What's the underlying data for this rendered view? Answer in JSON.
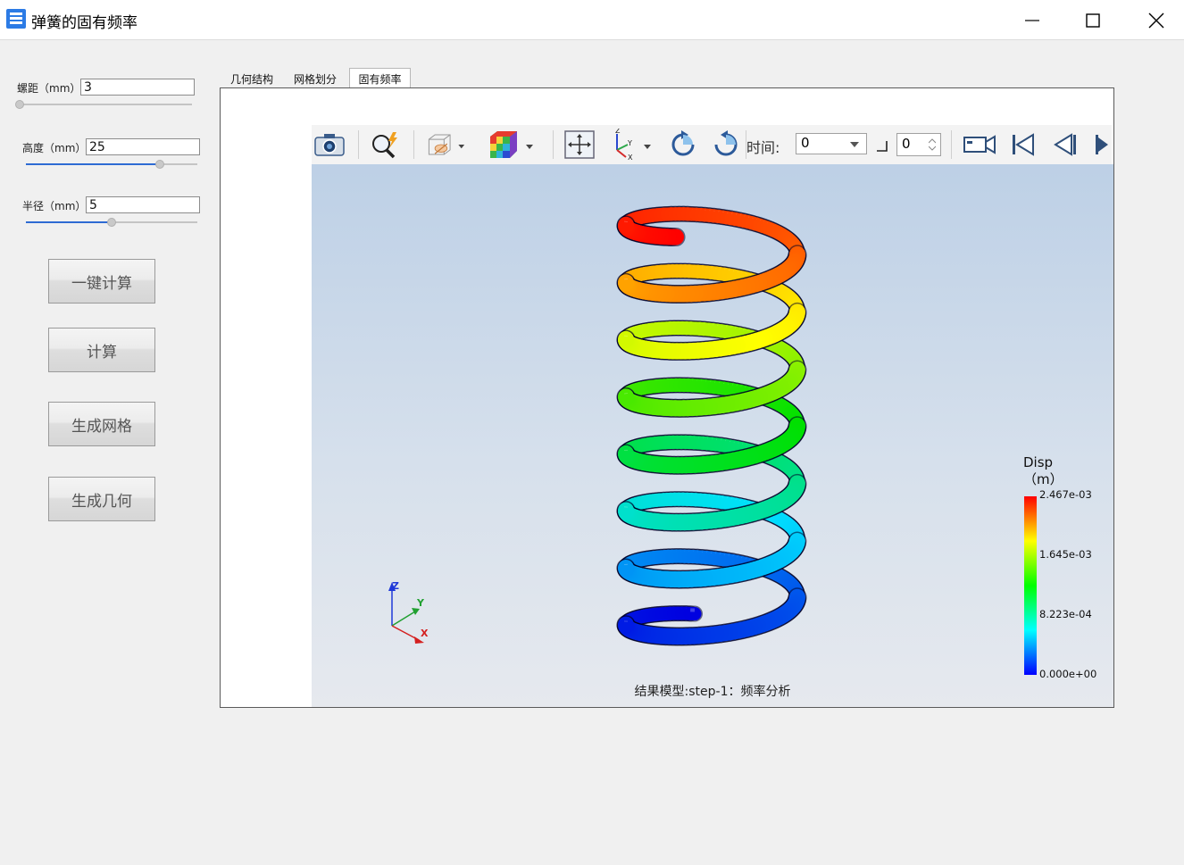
{
  "window": {
    "title": "弹簧的固有频率"
  },
  "params": [
    {
      "label": "螺距（mm）",
      "value": "3",
      "slider_fraction": 0.0
    },
    {
      "label": "高度（mm）",
      "value": "25",
      "slider_fraction": 0.78
    },
    {
      "label": "半径（mm）",
      "value": "5",
      "slider_fraction": 0.5
    }
  ],
  "buttons": {
    "one_click": "一键计算",
    "compute": "计算",
    "gen_mesh": "生成网格",
    "gen_geometry": "生成几何"
  },
  "tabs": [
    "几何结构",
    "网格划分",
    "固有频率"
  ],
  "active_tab": 2,
  "toolbar": {
    "time_label": "时间:",
    "time_value": "0",
    "step_value": "0"
  },
  "icons": {
    "camera": "camera-icon",
    "zoom": "zoom-icon",
    "box_view": "box-view-icon",
    "color_cube": "color-cube-icon",
    "fit": "fit-view-icon",
    "axes": "axes-icon",
    "rotate_cw": "rotate-cw-icon",
    "rotate_ccw": "rotate-ccw-icon",
    "record": "video-camera-icon",
    "first": "first-frame-icon",
    "prev": "prev-frame-icon",
    "next": "next-frame-icon"
  },
  "legend": {
    "title": "Disp",
    "unit": "（m）",
    "ticks": [
      "2.467e-03",
      "1.645e-03",
      "8.223e-04",
      "0.000e+00"
    ],
    "colors": [
      "#ff0000",
      "#ffff00",
      "#00ff00",
      "#00ffff",
      "#0000ff"
    ]
  },
  "axes_labels": {
    "x": "X",
    "y": "Y",
    "z": "Z"
  },
  "caption": "结果模型:step-1：频率分析"
}
